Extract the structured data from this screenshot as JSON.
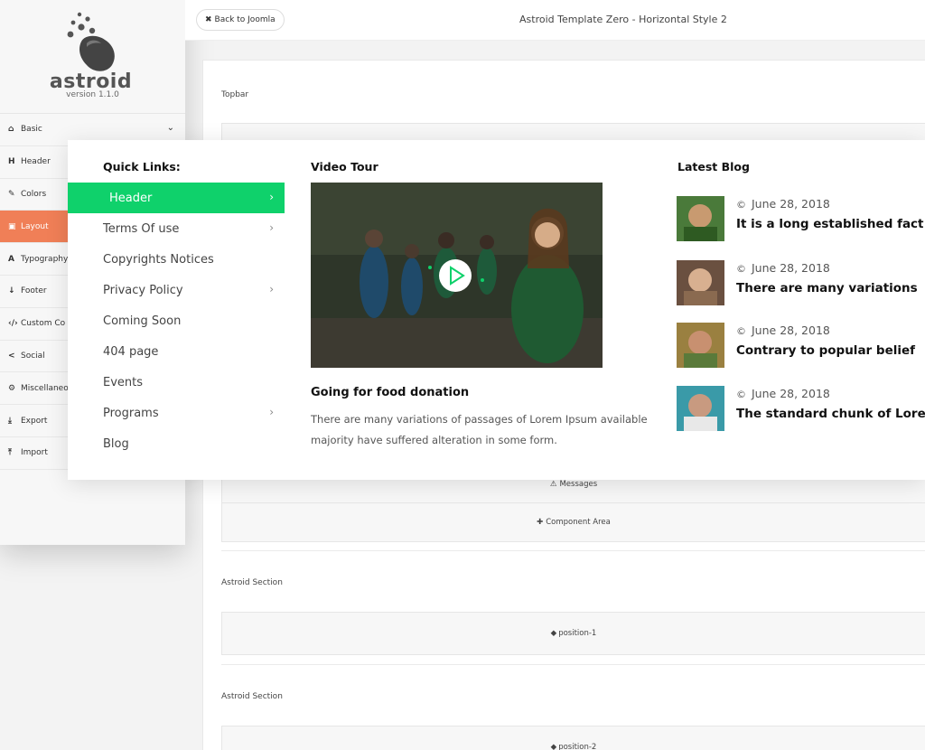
{
  "app": {
    "logo_text": "astroid",
    "version": "version 1.1.0"
  },
  "topbar": {
    "back_label": "Back to Joomla",
    "title": "Astroid Template Zero - Horizontal Style 2"
  },
  "sidebar": {
    "items": [
      {
        "icon": "home-icon",
        "glyph": "⌂",
        "label": "Basic",
        "active": false
      },
      {
        "icon": "header-icon",
        "glyph": "H",
        "label": "Header",
        "active": false
      },
      {
        "icon": "brush-icon",
        "glyph": "✎",
        "label": "Colors",
        "active": false
      },
      {
        "icon": "layout-icon",
        "glyph": "▣",
        "label": "Layout",
        "active": true
      },
      {
        "icon": "font-icon",
        "glyph": "A",
        "label": "Typography",
        "active": false
      },
      {
        "icon": "arrow-down-icon",
        "glyph": "↓",
        "label": "Footer",
        "active": false
      },
      {
        "icon": "code-icon",
        "glyph": "‹/›",
        "label": "Custom Co",
        "active": false
      },
      {
        "icon": "share-icon",
        "glyph": "<",
        "label": "Social",
        "active": false
      },
      {
        "icon": "cogs-icon",
        "glyph": "⚙",
        "label": "Miscellaneo",
        "active": false
      },
      {
        "icon": "download-icon",
        "glyph": "⤓",
        "label": "Export",
        "active": false
      },
      {
        "icon": "upload-icon",
        "glyph": "⤒",
        "label": "Import",
        "active": false
      }
    ]
  },
  "layout": {
    "topbar_section": "Topbar",
    "messages": "Messages",
    "component_area": "Component Area",
    "sections": [
      {
        "label": "Astroid Section",
        "position": "position-1"
      },
      {
        "label": "Astroid Section",
        "position": "position-2"
      }
    ]
  },
  "mega_menu": {
    "quick_links": {
      "title": "Quick Links:",
      "items": [
        {
          "label": "Header",
          "has_arrow": true,
          "active": true
        },
        {
          "label": "Terms Of use",
          "has_arrow": true,
          "active": false
        },
        {
          "label": "Copyrights Notices",
          "has_arrow": false,
          "active": false
        },
        {
          "label": "Privacy Policy",
          "has_arrow": true,
          "active": false
        },
        {
          "label": "Coming Soon",
          "has_arrow": false,
          "active": false
        },
        {
          "label": "404 page",
          "has_arrow": false,
          "active": false
        },
        {
          "label": "Events",
          "has_arrow": false,
          "active": false
        },
        {
          "label": "Programs",
          "has_arrow": true,
          "active": false
        },
        {
          "label": "Blog",
          "has_arrow": false,
          "active": false
        }
      ]
    },
    "video": {
      "title": "Video Tour",
      "caption_title": "Going for food donation",
      "caption_text": "There are many variations of passages of Lorem Ipsum available majority have suffered alteration in some form."
    },
    "blog": {
      "title": "Latest Blog",
      "posts": [
        {
          "date": "June 28, 2018",
          "title": "It is a long established fact"
        },
        {
          "date": "June 28, 2018",
          "title": "There are many variations"
        },
        {
          "date": "June 28, 2018",
          "title": "Contrary to popular belief"
        },
        {
          "date": "June 28, 2018",
          "title": "The standard chunk of Lorem"
        }
      ]
    }
  },
  "colors": {
    "accent_active": "#f07f57",
    "menu_highlight": "#0fd16b"
  }
}
